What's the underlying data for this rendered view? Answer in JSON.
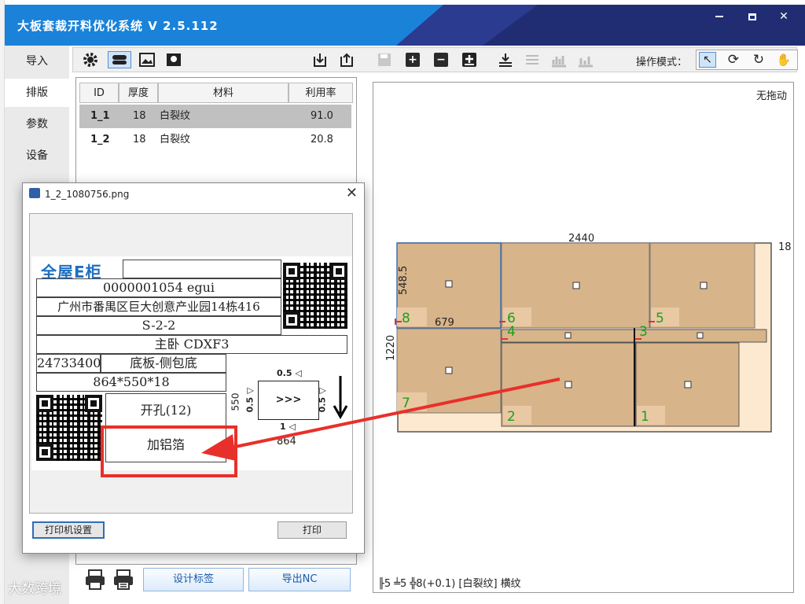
{
  "app": {
    "title": "大板套裁开料优化系统  V 2.5.112",
    "window_buttons": [
      "minimize",
      "maximize",
      "close"
    ],
    "close_glyph": "✕"
  },
  "sidebar": {
    "items": [
      {
        "label": "导入",
        "active": false
      },
      {
        "label": "排版",
        "active": true
      },
      {
        "label": "参数",
        "active": false
      },
      {
        "label": "设备",
        "active": false
      }
    ]
  },
  "toolbar": {
    "icons": [
      "gear-icon",
      "layers-icon",
      "image-icon",
      "print-preview-icon",
      "import-icon",
      "export-icon",
      "save-icon",
      "add-icon",
      "remove-icon",
      "add-board-icon",
      "download-icon",
      "upload-icon",
      "chart-icon",
      "chart2-icon"
    ],
    "add_glyph": "+",
    "remove_glyph": "−",
    "mode_label": "操作模式：",
    "mode_icons": [
      "pointer-icon",
      "rotate-icon",
      "refresh-icon",
      "hand-icon"
    ],
    "mode_pointer_glyph": "↖",
    "mode_rotate_glyph": "⟳",
    "mode_refresh_glyph": "↻",
    "mode_hand_glyph": "✋"
  },
  "table": {
    "headers": [
      "ID",
      "厚度",
      "材料",
      "利用率"
    ],
    "rows": [
      {
        "id": "1_1",
        "thickness": "18",
        "material": "白裂纹",
        "rate": "91.0",
        "selected": true
      },
      {
        "id": "1_2",
        "thickness": "18",
        "material": "白裂纹",
        "rate": "20.8",
        "selected": false
      }
    ]
  },
  "list_buttons": {
    "design_label": "设计标签",
    "export_label": "导出NC"
  },
  "canvas": {
    "drag_status": "无拖动",
    "board_width_label": "2440",
    "board_height_label": "1220",
    "board_thickness_label": "18",
    "panel_height_label": "548.5",
    "panel_width_label": "679",
    "part_numbers": [
      "8",
      "6",
      "5",
      "4",
      "3",
      "7",
      "2",
      "1"
    ],
    "status": "╟5 ╧5  ╬8(+0.1)   [白裂纹]  横纹"
  },
  "dialog": {
    "title": "1_2_1080756.png",
    "close_glyph": "✕",
    "label": {
      "brand": "全屋E柜",
      "order_no": "0000001054  egui",
      "address": "广州市番禺区巨大创意产业园14栋416",
      "code": "S-2-2",
      "room": "主卧  CDXF3",
      "part_id": "24733400",
      "part_name": "底板-侧包底",
      "size": "864*550*18",
      "holes": "开孔(12)",
      "extra": "加铝箔",
      "edge_top": "0.5 ◁",
      "edge_left": "0.5 ▽",
      "edge_right": "0.5 ▽",
      "edge_bottom": "1 ◁",
      "side_dim": "550",
      "bottom_dim": "864",
      "grain": ">>>"
    },
    "printer_settings_label": "打印机设置",
    "print_label": "打印"
  },
  "watermark": "大数跨境",
  "colors": {
    "title_bar": "#1a82d9",
    "panel_fill": "#d8b48a",
    "board_fill": "#fde9cf",
    "highlight": "#e8302a",
    "part_number": "#1e9e1e"
  }
}
